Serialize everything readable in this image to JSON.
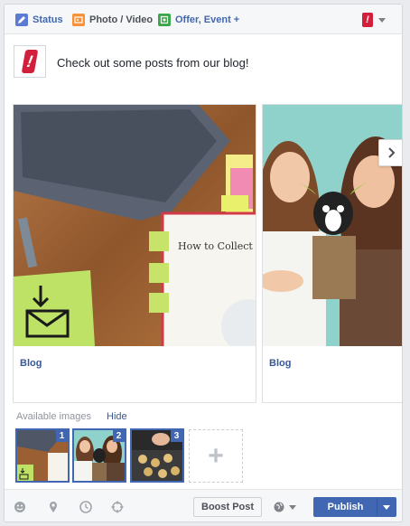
{
  "tabs": {
    "status": "Status",
    "photo_video": "Photo / Video",
    "offer_event": "Offer, Event +"
  },
  "page_selector": {
    "logo_letter": "!"
  },
  "post": {
    "avatar_letter": "!",
    "message": "Check out some posts from our blog!"
  },
  "carousel": {
    "cards": [
      {
        "label": "Blog",
        "image": "desk-laptop-notebook-sticky-notes"
      },
      {
        "label": "Blog",
        "image": "two-women-with-dog-in-costume"
      }
    ],
    "next_icon": "chevron-right-icon"
  },
  "available_images": {
    "label": "Available images",
    "hide_label": "Hide",
    "thumbs": [
      {
        "number": "1"
      },
      {
        "number": "2"
      },
      {
        "number": "3"
      }
    ],
    "add_label": "+"
  },
  "footer": {
    "icons": [
      "smiley-icon",
      "location-pin-icon",
      "clock-icon",
      "target-icon"
    ],
    "boost_label": "Boost Post",
    "publish_label": "Publish"
  },
  "colors": {
    "brand_blue": "#4267b2",
    "link_blue": "#365899",
    "logo_red": "#d21f3c"
  }
}
